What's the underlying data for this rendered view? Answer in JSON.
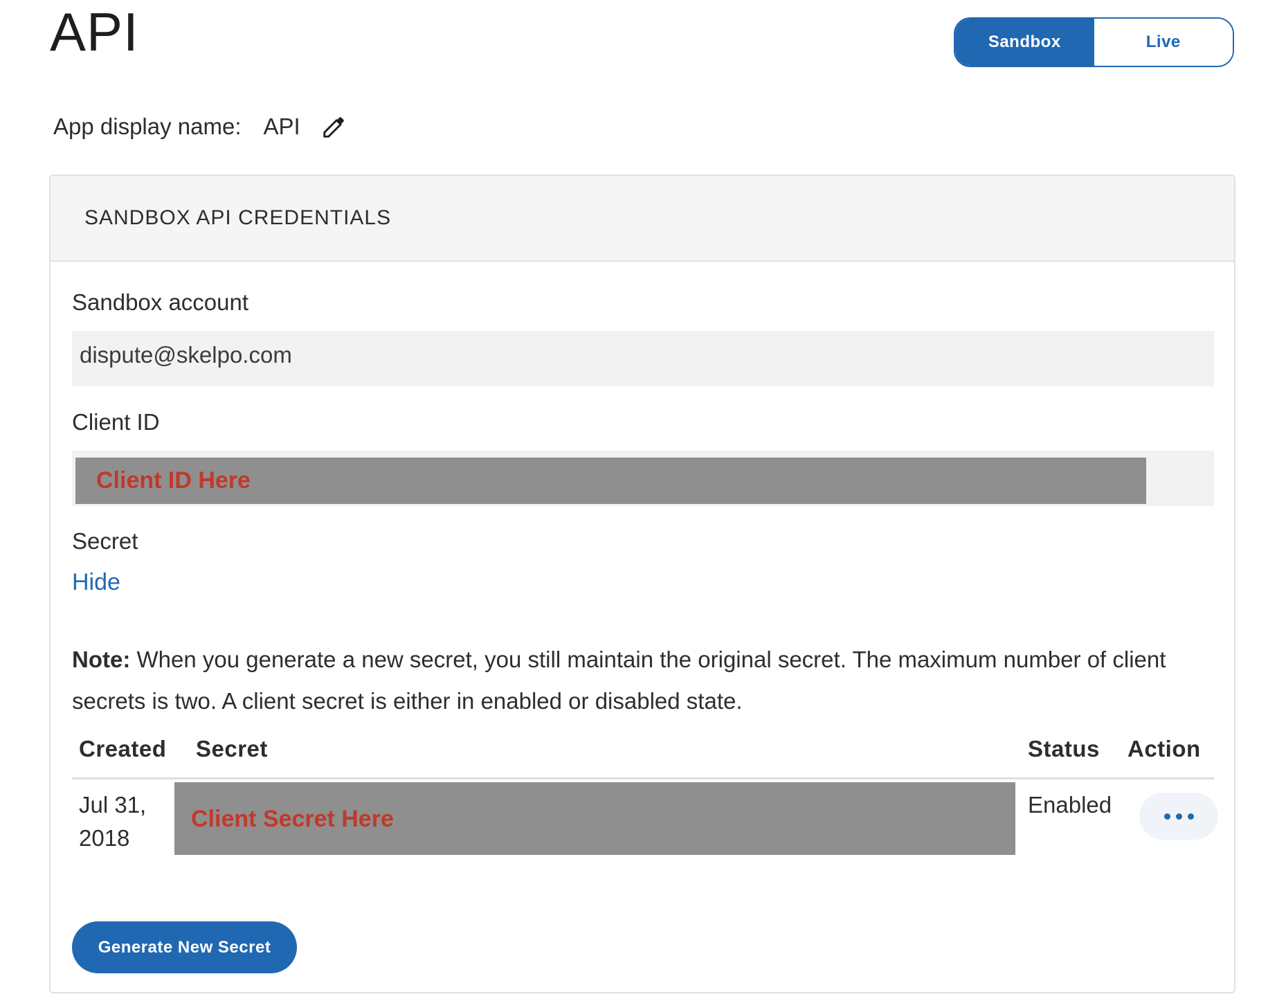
{
  "page": {
    "title": "API"
  },
  "env_toggle": {
    "options": [
      {
        "label": "Sandbox",
        "selected": true
      },
      {
        "label": "Live",
        "selected": false
      }
    ]
  },
  "display_name": {
    "label": "App display name:",
    "value": "API",
    "edit_icon": "pencil-icon"
  },
  "credentials": {
    "header": "SANDBOX API CREDENTIALS",
    "sandbox_account_label": "Sandbox account",
    "sandbox_account_value": "dispute@skelpo.com",
    "client_id_label": "Client ID",
    "client_id_value": "Client ID Here",
    "secret_label": "Secret",
    "hide_link": "Hide",
    "note_bold": "Note:",
    "note_text": " When you generate a new secret, you still maintain the original secret. The maximum number of client secrets is two. A client secret is either in enabled or disabled state."
  },
  "secrets_table": {
    "columns": [
      "Created",
      "Secret",
      "Status",
      "Action"
    ],
    "rows": [
      {
        "created_line1": "Jul 31,",
        "created_line2": "2018",
        "secret": "Client Secret Here",
        "status": "Enabled",
        "action_icon": "more-dots-icon"
      }
    ]
  },
  "generate_button": "Generate New Secret",
  "colors": {
    "accent": "#2168b2",
    "redaction": "#8f8f8f",
    "redaction_text": "#c0392b",
    "card_header_bg": "#f5f5f5"
  }
}
